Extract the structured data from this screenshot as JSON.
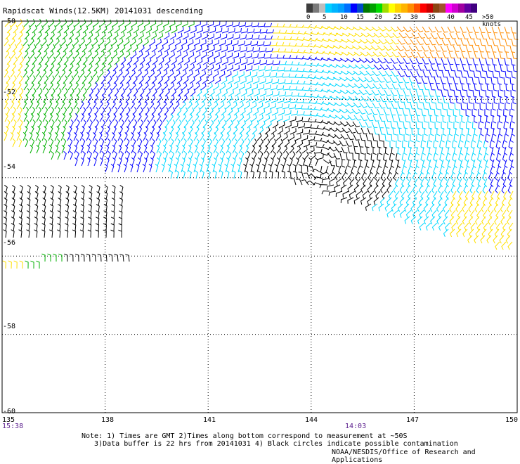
{
  "title": "Rapidscat Winds(12.5KM) 20141031 descending",
  "legend": {
    "labels": [
      "0",
      "5",
      "10",
      "15",
      "20",
      "25",
      "30",
      "35",
      "40",
      "45",
      ">50 knots"
    ],
    "colors": [
      "#3d3d3d",
      "#7a7a7a",
      "#bdbdbd",
      "#00d0ff",
      "#00b4ff",
      "#00a0ff",
      "#0070ff",
      "#0000ff",
      "#004ac8",
      "#007800",
      "#00a000",
      "#00dc00",
      "#a0dc00",
      "#ffff00",
      "#ffd200",
      "#ffb400",
      "#ff8c00",
      "#ff5000",
      "#ff0000",
      "#c80000",
      "#8b4513",
      "#a0522d",
      "#ff00ff",
      "#d000d0",
      "#a000a0",
      "#6000a0",
      "#400080"
    ]
  },
  "axes": {
    "lat_labels": [
      "-50",
      "-52",
      "-54",
      "-56",
      "-58",
      "-60"
    ],
    "lon_labels": [
      "135",
      "138",
      "141",
      "144",
      "147",
      "150"
    ]
  },
  "times": [
    "15:38",
    "14:03"
  ],
  "notes": "Note: 1) Times are GMT 2)Times along bottom correspond to measurement at ~50S\n   3)Data buffer is 22 hrs from 20141031 4) Black circles indicate possible contamination",
  "credit": "NOAA/NESDIS/Office of Research and Applications",
  "map": {
    "lon_range": [
      135,
      150
    ],
    "lat_range": [
      -60,
      -50
    ],
    "low_center": {
      "lon": 144.3,
      "lat": -53.7
    },
    "swath": "descending",
    "speed_colors": [
      "#000000",
      "#00d8ff",
      "#0000ff",
      "#00b000",
      "#ffe000",
      "#ff8c00",
      "#c84800"
    ]
  }
}
